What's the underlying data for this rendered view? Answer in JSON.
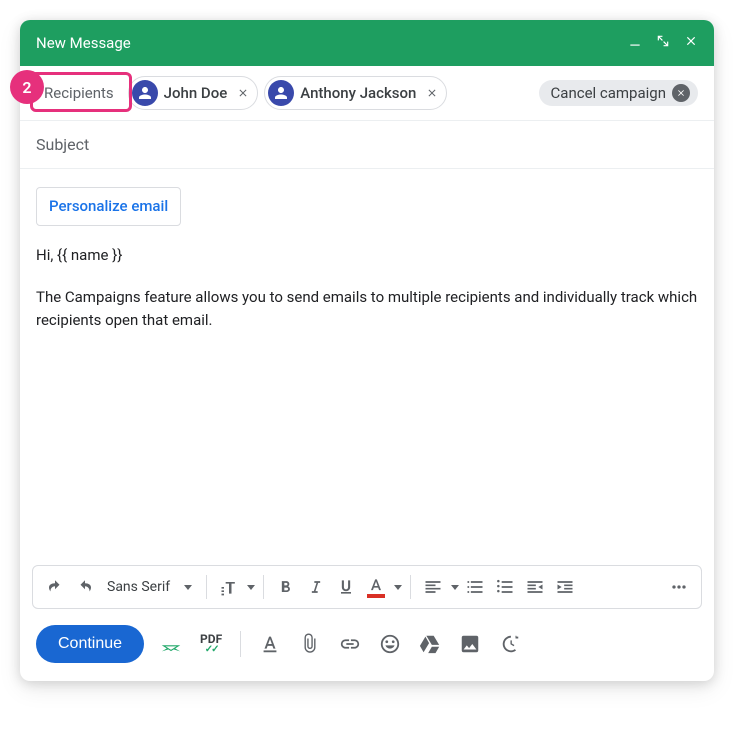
{
  "callout": {
    "number": "2"
  },
  "header": {
    "title": "New Message"
  },
  "recipients": {
    "label": "Recipients",
    "chips": [
      {
        "name": "John Doe"
      },
      {
        "name": "Anthony Jackson"
      }
    ],
    "cancel_campaign": "Cancel campaign"
  },
  "subject": {
    "placeholder": "Subject"
  },
  "body": {
    "personalize_label": "Personalize email",
    "greeting": "Hi, {{ name }}",
    "paragraph": "The Campaigns feature allows you to send emails to multiple recipients and individually track which recipients open that email."
  },
  "format_toolbar": {
    "font": "Sans Serif"
  },
  "actions": {
    "continue_label": "Continue"
  },
  "text_color_underline": "#d93025",
  "pdf_label": "PDF"
}
